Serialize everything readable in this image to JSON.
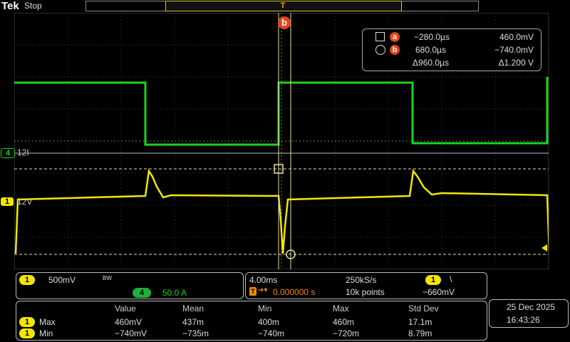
{
  "header": {
    "brand": "Tek",
    "run_state": "Stop"
  },
  "trigger_marker": "T",
  "cursor_b_label": "b",
  "channels": {
    "ch4": {
      "number": "4",
      "label": "12I",
      "color": "#1fd11f"
    },
    "ch1": {
      "number": "1",
      "label": "12V",
      "color": "#f2e600"
    }
  },
  "cursors": {
    "a": {
      "badge": "a",
      "time": "−280.0µs",
      "value": "460.0mV"
    },
    "b": {
      "badge": "b",
      "time": "680.0µs",
      "value": "−740.0mV"
    },
    "delta": {
      "time": "Δ960.0µs",
      "value": "Δ1.200 V"
    }
  },
  "vertical": {
    "ch1_badge": "1",
    "ch1_scale": "500mV",
    "bw": "BW",
    "ch4_badge": "4",
    "ch4_scale": "50.0 A"
  },
  "horizontal": {
    "time_div": "4.00ms",
    "sample_rate": "250kS/s",
    "trigger_pos": "0.000000 s",
    "record": "10k points",
    "trig_src_badge": "1",
    "trig_slope": "\\",
    "trig_level": "−660mV"
  },
  "measurements": {
    "headers": [
      "Value",
      "Mean",
      "Min",
      "Max",
      "Std Dev"
    ],
    "rows": [
      {
        "ch": "1",
        "name": "Max",
        "cells": [
          "460mV",
          "437m",
          "400m",
          "460m",
          "17.1m"
        ]
      },
      {
        "ch": "1",
        "name": "Min",
        "cells": [
          "−740mV",
          "−735m",
          "−740m",
          "−720m",
          "8.79m"
        ]
      }
    ]
  },
  "datetime": {
    "date": "25 Dec  2025",
    "time": "16:43:26"
  },
  "colors": {
    "ch1": "#f2e600",
    "ch4": "#1fd11f",
    "cursor": "#e8e0a0",
    "accent": "#e2431d"
  }
}
